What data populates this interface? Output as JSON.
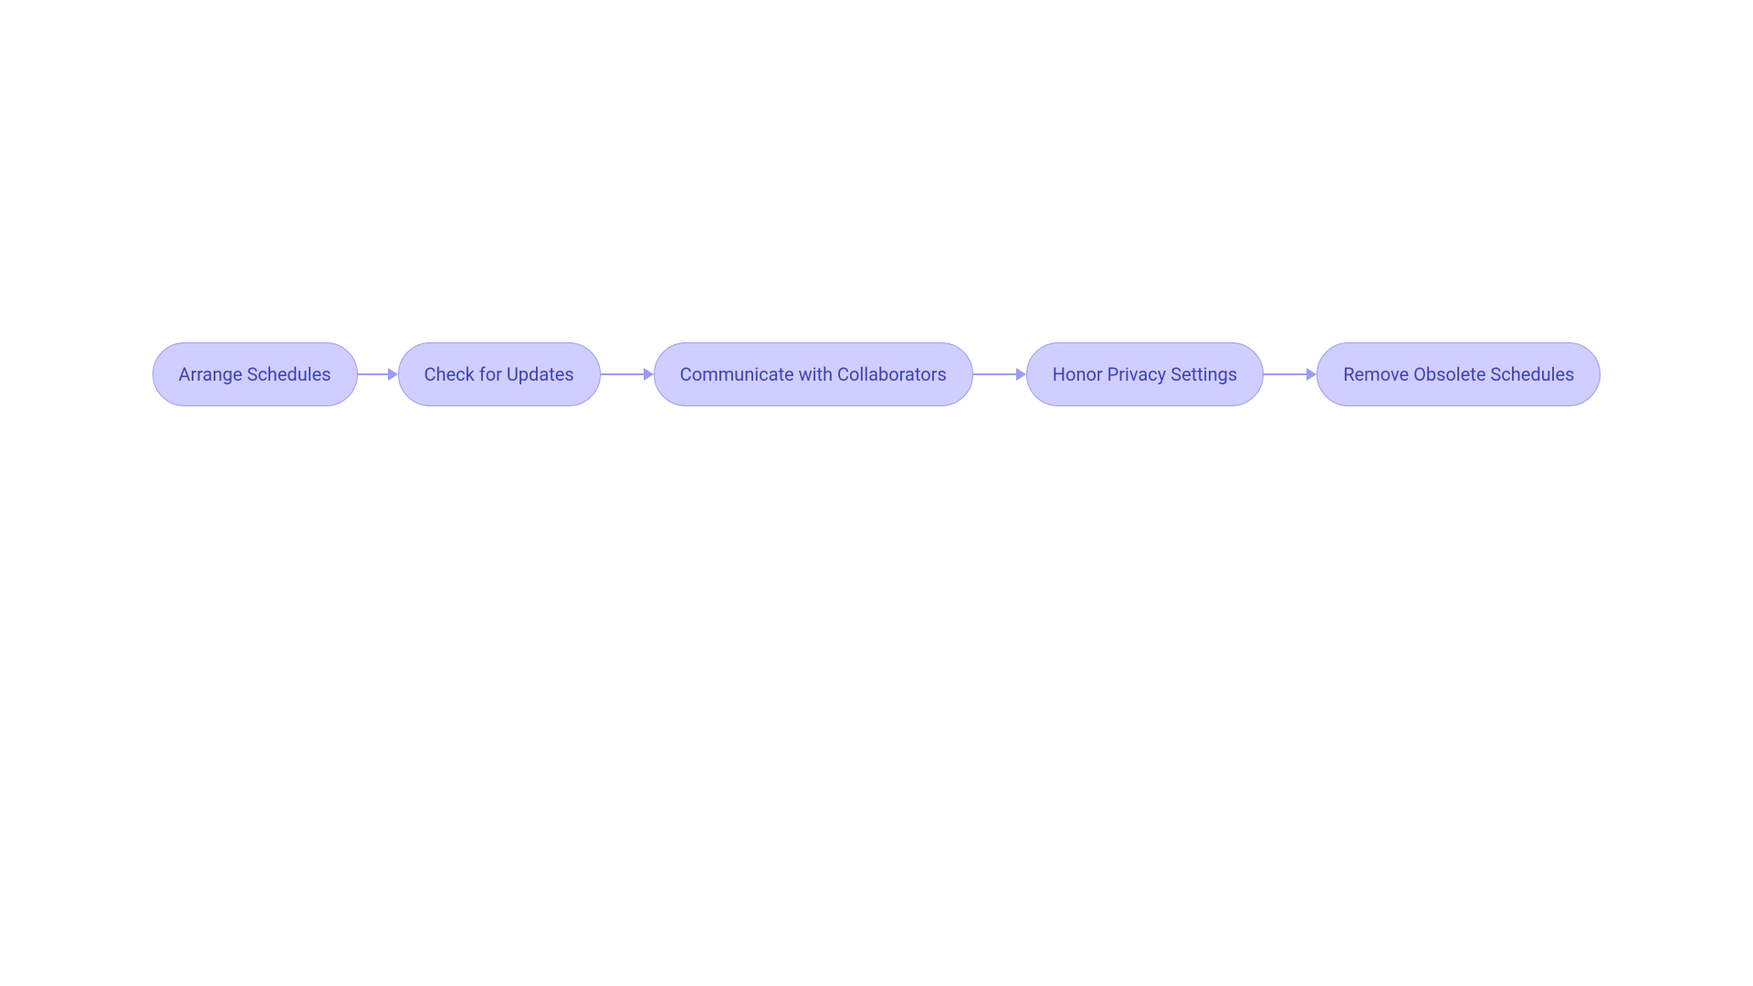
{
  "diagram": {
    "nodes": [
      {
        "label": "Arrange Schedules"
      },
      {
        "label": "Check for Updates"
      },
      {
        "label": "Communicate with Collaborators"
      },
      {
        "label": "Honor Privacy Settings"
      },
      {
        "label": "Remove Obsolete Schedules"
      }
    ],
    "colors": {
      "node_fill": "#cfceff",
      "node_stroke": "#9d9bf0",
      "text": "#4042b0",
      "arrow": "#9d9bf0"
    }
  }
}
